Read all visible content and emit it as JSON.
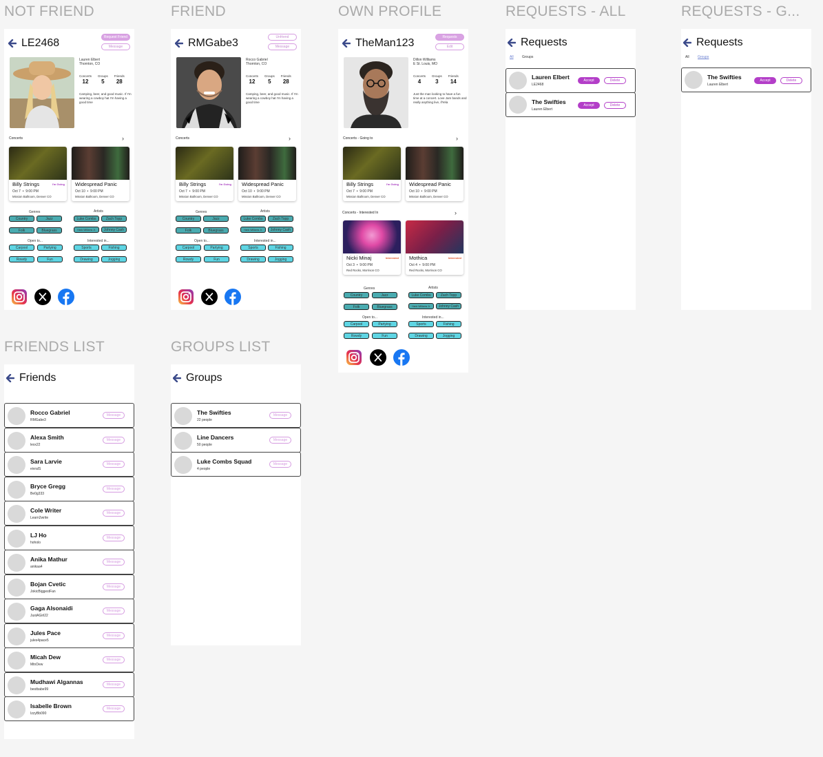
{
  "labels": {
    "not_friend": "NOT FRIEND",
    "friend": "FRIEND",
    "own": "OWN PROFILE",
    "req_all": "REQUESTS - ALL",
    "req_groups": "REQUESTS - G...",
    "friends_list": "FRIENDS LIST",
    "groups_list": "GROUPS LIST"
  },
  "stat_labels": {
    "concerts": "Concerts",
    "groups": "Groups",
    "friends": "Friends"
  },
  "groups_head": {
    "genres": "Genres",
    "artists": "Artists",
    "open": "Open to...",
    "interested": "Interested in..."
  },
  "genres": [
    "Country",
    "Jazz",
    "Folk",
    "Bluegrass"
  ],
  "artists": [
    "Luke Combs",
    "Zach Topp",
    "Hank Williams Jr.",
    "Johnny Cash"
  ],
  "open_to": [
    "Carpool",
    "Partying",
    "Rowdy",
    "Fun"
  ],
  "interested_in": [
    "Sports",
    "Fishing",
    "Drawing",
    "Jogging"
  ],
  "concert_cards": [
    {
      "title": "Billy Strings",
      "tag": "I'm Going",
      "date": "Oct 7",
      "time": "9:00 PM",
      "venue": "Mission Ballroom, Denver CO"
    },
    {
      "title": "Widespread Panic",
      "tag": "",
      "date": "Oct 10",
      "time": "9:00 PM",
      "venue": "Mission Ballroom, Denver CO"
    }
  ],
  "interested_cards": [
    {
      "title": "Nicki Minaj",
      "tag": "Interested",
      "date": "Oct 3",
      "time": "9:00 PM",
      "venue": "Red Rocks, Morrison CO"
    },
    {
      "title": "Mothica",
      "tag": "Interested",
      "date": "Oct 4",
      "time": "9:00 PM",
      "venue": "Red Rocks, Morrison CO"
    }
  ],
  "p1": {
    "username": "LE2468",
    "btn1": "Request Friend",
    "btn2": "Message",
    "name": "Lauren Elbert",
    "loc": "Thornton, CO",
    "concerts": "12",
    "groups": "5",
    "friends": "28",
    "bio": "Camping, beer, and good music. If I'm wearing a cowboy hat I'm having a good time",
    "section": "Concerts"
  },
  "p2": {
    "username": "RMGabe3",
    "btn1": "Unfriend",
    "btn2": "Message",
    "name": "Rocco Gabriel",
    "loc": "Thornton, CO",
    "concerts": "12",
    "groups": "5",
    "friends": "28",
    "bio": "Camping, beer, and good music. If I'm wearing a cowboy hat I'm having a good time",
    "section": "Concerts"
  },
  "p3": {
    "username": "TheMan123",
    "btn1": "Requests",
    "btn2": "Edit",
    "name": "Dillon Williams",
    "loc": "E St. Louis, MO",
    "concerts": "4",
    "groups": "3",
    "friends": "14",
    "bio": "Just the man looking to have a fun time at a concert. Love Jam bands and really anything live, ifYela",
    "section": "Concerts - Going to",
    "section2": "Concerts - Interested In"
  },
  "requests": {
    "title": "Requests",
    "tab_all": "All",
    "tab_groups": "Groups",
    "accept": "Accept",
    "delete": "Delete",
    "all_items": [
      {
        "name": "Lauren Elbert",
        "sub": "LE2468"
      },
      {
        "name": "The Swifties",
        "sub": "Lauren Elbert"
      }
    ],
    "group_items": [
      {
        "name": "The Swifties",
        "sub": "Lauren Elbert"
      }
    ]
  },
  "friends": {
    "title": "Friends",
    "msg": "Message",
    "items": [
      {
        "name": "Rocco Gabriel",
        "sub": "RMGabe3"
      },
      {
        "name": "Alexa Smith",
        "sub": "lexx22"
      },
      {
        "name": "Sara Larvie",
        "sub": "eivralS"
      },
      {
        "name": "Bryce Gregg",
        "sub": "Be0g333"
      },
      {
        "name": "Cole Writer",
        "sub": "Learn2write"
      },
      {
        "name": "LJ Ho",
        "sub": "hoholo"
      },
      {
        "name": "Anika Mathur",
        "sub": "anikaa4"
      },
      {
        "name": "Bojan Cvetic",
        "sub": "JokicBiggestFan"
      },
      {
        "name": "Gaga Alsonaidi",
        "sub": "JustAGirl22"
      },
      {
        "name": "Jules Pace",
        "sub": "jules4pace5"
      },
      {
        "name": "Micah Dew",
        "sub": "MtnDew"
      },
      {
        "name": "Mudhawi Algannas",
        "sub": "bestbabe99"
      },
      {
        "name": "Isabelle Brown",
        "sub": "IzzyBb090"
      }
    ]
  },
  "groups": {
    "title": "Groups",
    "msg": "Message",
    "items": [
      {
        "name": "The Swifties",
        "sub": "22 people"
      },
      {
        "name": "Line Dancers",
        "sub": "50 people"
      },
      {
        "name": "Luke Combs Squad",
        "sub": "4 people"
      }
    ]
  },
  "colors": {
    "teal_dark": "#4aabb0",
    "teal_light": "#5fd5e3",
    "purple": "#b33ec8",
    "pink_outline": "#d59be0"
  },
  "icons": [
    "back-arrow-icon",
    "instagram-icon",
    "x-icon",
    "facebook-icon",
    "chevron-right-icon"
  ]
}
